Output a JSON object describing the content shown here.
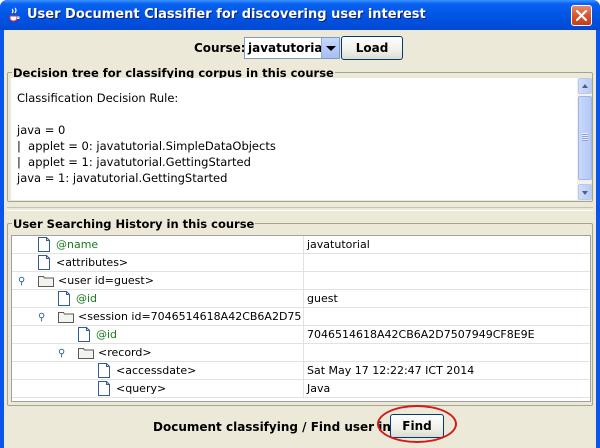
{
  "window": {
    "title": "User Document Classifier for discovering user interest",
    "title_icon": "java-cup-icon",
    "close_icon": "close-icon"
  },
  "course": {
    "label": "Course:",
    "selected": "javatutorial",
    "load_label": "Load"
  },
  "decision_panel": {
    "title": "Decision tree for classifying corpus in this course",
    "lines": [
      "Classification Decision Rule:",
      "",
      "java = 0",
      "|  applet = 0: javatutorial.SimpleDataObjects",
      "|  applet = 1: javatutorial.GettingStarted",
      "java = 1: javatutorial.GettingStarted"
    ]
  },
  "history_panel": {
    "title": "User Searching History in this course",
    "rows": [
      {
        "label": "@name",
        "value": "javatutorial",
        "kind": "attribute",
        "depth": 1
      },
      {
        "label": "<attributes>",
        "value": "",
        "kind": "element",
        "depth": 1
      },
      {
        "label": "<user id=guest>",
        "value": "",
        "kind": "folder",
        "depth": 1,
        "toggle": "expanded"
      },
      {
        "label": "@id",
        "value": "guest",
        "kind": "attribute",
        "depth": 2
      },
      {
        "label": "<session id=7046514618A42CB6A2D75",
        "value": "",
        "kind": "folder",
        "depth": 2,
        "toggle": "expanded"
      },
      {
        "label": "@id",
        "value": "7046514618A42CB6A2D7507949CF8E9E",
        "kind": "attribute",
        "depth": 3
      },
      {
        "label": "<record>",
        "value": "",
        "kind": "folder",
        "depth": 3,
        "toggle": "expanded"
      },
      {
        "label": "<accessdate>",
        "value": "Sat May 17 12:22:47 ICT 2014",
        "kind": "element",
        "depth": 4
      },
      {
        "label": "<query>",
        "value": "Java",
        "kind": "element",
        "depth": 4
      }
    ]
  },
  "footer": {
    "label": "Document classifying / Find user interest",
    "find_label": "Find"
  },
  "colors": {
    "title_bar": "#0054e3",
    "attribute_text": "#1a7a1a",
    "highlight_ring": "#d11a1a"
  }
}
